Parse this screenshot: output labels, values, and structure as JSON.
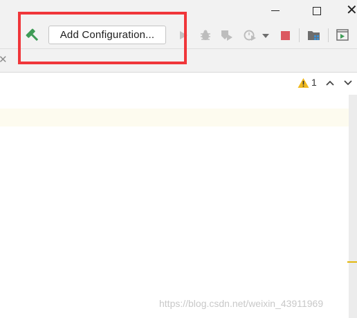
{
  "toolbar": {
    "add_configuration_label": "Add Configuration...",
    "icons": [
      "hammer-icon",
      "run-icon",
      "debug-icon",
      "coverage-icon",
      "profile-icon",
      "dropdown-icon",
      "stop-icon",
      "project-structure-icon",
      "run-console-icon"
    ],
    "colors": {
      "build": "#3e9b56",
      "stop": "#db5860",
      "highlight": "#f0363a"
    }
  },
  "inspection": {
    "warning_count": "1"
  },
  "watermark": "https://blog.csdn.net/weixin_43911969"
}
